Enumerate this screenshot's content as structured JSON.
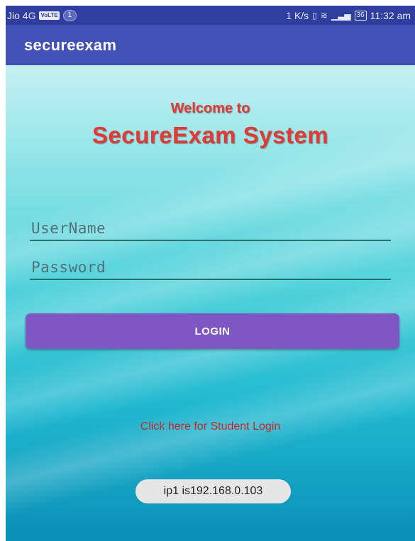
{
  "status_bar": {
    "carrier": "Jio 4G",
    "volte": "VoLTE",
    "notification_count": "1",
    "speed": "1 K/s",
    "battery": "36",
    "time": "11:32 am",
    "icons": [
      "vibrate-icon",
      "wifi-icon",
      "signal-icon",
      "battery-icon"
    ]
  },
  "app_bar": {
    "title": "secureexam"
  },
  "welcome": {
    "line1": "Welcome to",
    "line2": "SecureExam System"
  },
  "form": {
    "username_placeholder": "UserName",
    "password_placeholder": "Password",
    "login_label": "LOGIN"
  },
  "links": {
    "student_login": "Click here for Student Login"
  },
  "toast": {
    "ip_text": "ip1 is192.168.0.103"
  },
  "colors": {
    "status_bar": "#303f9f",
    "app_bar": "#3f51b5",
    "title_red": "#e53935",
    "button": "#7e57c2",
    "link": "#c62828"
  }
}
